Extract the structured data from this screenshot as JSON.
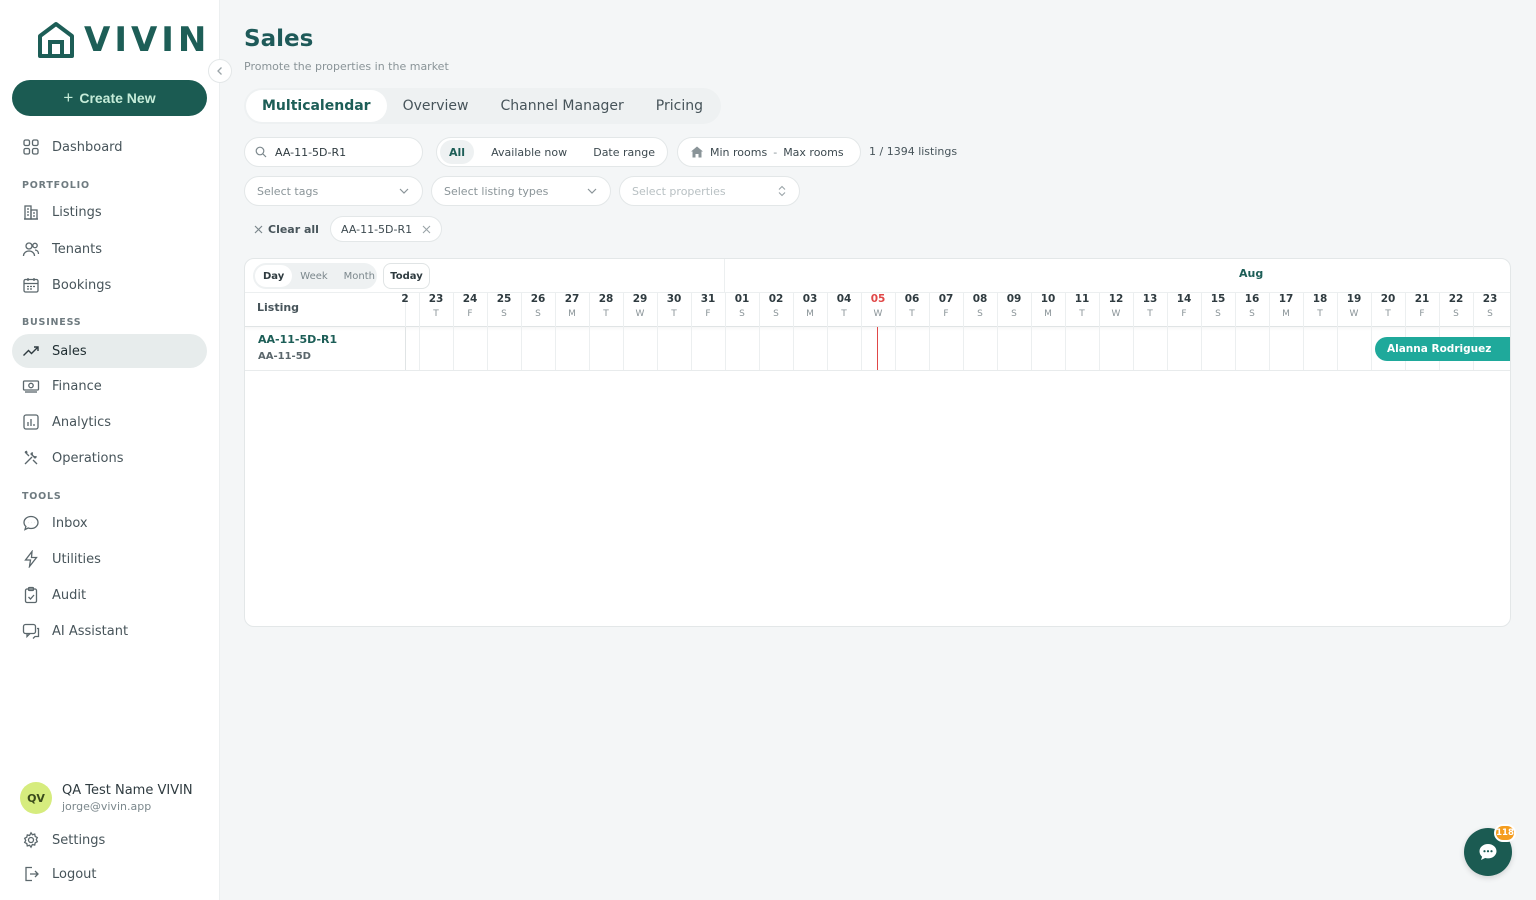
{
  "brand": {
    "logo_text": "VIVIN",
    "accent": "#1b5b52"
  },
  "sidebar": {
    "create_label": "Create New",
    "dashboard": "Dashboard",
    "portfolio_label": "PORTFOLIO",
    "portfolio_items": [
      "Listings",
      "Tenants",
      "Bookings"
    ],
    "business_label": "BUSINESS",
    "business_items": [
      "Sales",
      "Finance",
      "Analytics",
      "Operations"
    ],
    "tools_label": "TOOLS",
    "tools_items": [
      "Inbox",
      "Utilities",
      "Audit",
      "AI Assistant"
    ],
    "user": {
      "initials": "QV",
      "name": "QA Test Name VIVIN",
      "email": "jorge@vivin.app"
    },
    "settings": "Settings",
    "logout": "Logout"
  },
  "page": {
    "title": "Sales",
    "subtitle": "Promote the properties in the market",
    "tabs": [
      "Multicalendar",
      "Overview",
      "Channel Manager",
      "Pricing"
    ],
    "active_tab": "Multicalendar"
  },
  "filters": {
    "search_value": "AA-11-5D-R1",
    "availability": [
      "All",
      "Available now",
      "Date range"
    ],
    "min_rooms": "Min rooms",
    "rooms_sep": "-",
    "max_rooms": "Max rooms",
    "listing_count": "1 / 1394 listings",
    "tags_placeholder": "Select tags",
    "types_placeholder": "Select listing types",
    "properties_placeholder": "Select properties",
    "clear_all": "Clear all",
    "active_chip": "AA-11-5D-R1"
  },
  "calendar": {
    "views": [
      "Day",
      "Week",
      "Month"
    ],
    "today_label": "Today",
    "listing_header": "Listing",
    "month": "Aug",
    "partial_day": "2",
    "days": [
      {
        "n": "23",
        "w": "T"
      },
      {
        "n": "24",
        "w": "F"
      },
      {
        "n": "25",
        "w": "S"
      },
      {
        "n": "26",
        "w": "S"
      },
      {
        "n": "27",
        "w": "M"
      },
      {
        "n": "28",
        "w": "T"
      },
      {
        "n": "29",
        "w": "W"
      },
      {
        "n": "30",
        "w": "T"
      },
      {
        "n": "31",
        "w": "F"
      },
      {
        "n": "01",
        "w": "S"
      },
      {
        "n": "02",
        "w": "S"
      },
      {
        "n": "03",
        "w": "M"
      },
      {
        "n": "04",
        "w": "T"
      },
      {
        "n": "05",
        "w": "W"
      },
      {
        "n": "06",
        "w": "T"
      },
      {
        "n": "07",
        "w": "F"
      },
      {
        "n": "08",
        "w": "S"
      },
      {
        "n": "09",
        "w": "S"
      },
      {
        "n": "10",
        "w": "M"
      },
      {
        "n": "11",
        "w": "T"
      },
      {
        "n": "12",
        "w": "W"
      },
      {
        "n": "13",
        "w": "T"
      },
      {
        "n": "14",
        "w": "F"
      },
      {
        "n": "15",
        "w": "S"
      },
      {
        "n": "16",
        "w": "S"
      },
      {
        "n": "17",
        "w": "M"
      },
      {
        "n": "18",
        "w": "T"
      },
      {
        "n": "19",
        "w": "W"
      },
      {
        "n": "20",
        "w": "T"
      },
      {
        "n": "21",
        "w": "F"
      },
      {
        "n": "22",
        "w": "S"
      },
      {
        "n": "23",
        "w": "S"
      }
    ],
    "today_date": "05",
    "row": {
      "name": "AA-11-5D-R1",
      "sub": "AA-11-5D"
    },
    "booking_guest": "Alanna Rodriguez"
  },
  "chat": {
    "badge": "118"
  }
}
